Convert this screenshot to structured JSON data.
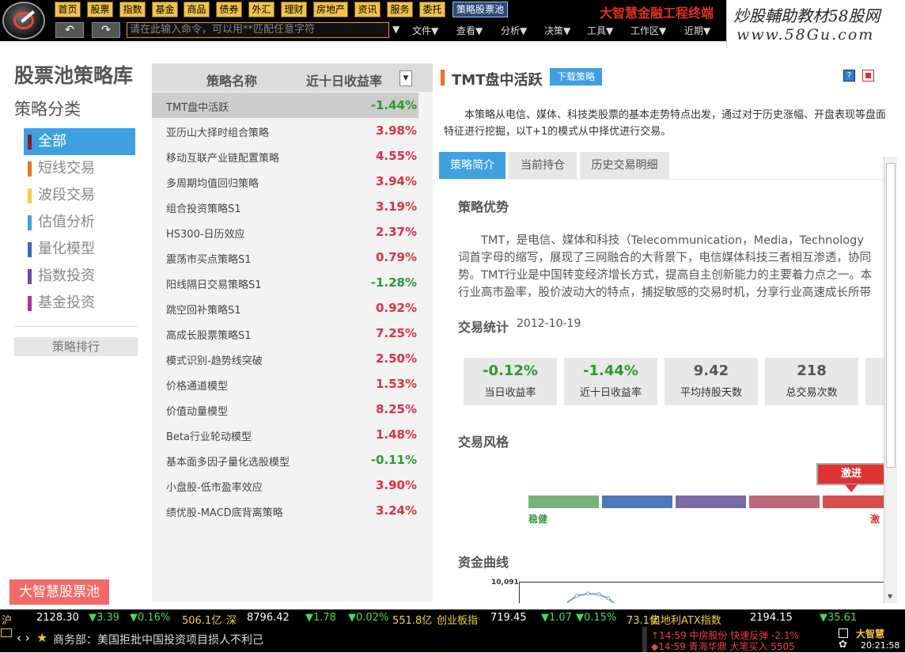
{
  "toolbar": {
    "menu": [
      "首页",
      "股票",
      "指数",
      "基金",
      "商品",
      "债券",
      "外汇",
      "理财",
      "房地产",
      "资讯",
      "服务",
      "委托",
      "策略股票池"
    ],
    "command_placeholder": "请在此输入命令，可以用**匹配任意字符",
    "dropdowns": [
      "文件▼",
      "查看▼",
      "分析▼",
      "决策▼",
      "工具▼",
      "工作区▼",
      "近期▼"
    ],
    "brand": "大智慧金融工程终端",
    "watermark_line1": "炒股輔助教材58股网",
    "watermark_line2": "www.58Gu.com"
  },
  "sidebar": {
    "title": "股票池策略库",
    "category_title": "策略分类",
    "categories": [
      {
        "label": "全部",
        "color": "#8a1a2a"
      },
      {
        "label": "短线交易",
        "color": "#f07020"
      },
      {
        "label": "波段交易",
        "color": "#f0d040"
      },
      {
        "label": "估值分析",
        "color": "#3fa0e0"
      },
      {
        "label": "量化模型",
        "color": "#3a6ab0"
      },
      {
        "label": "指数投资",
        "color": "#6a4ab0"
      },
      {
        "label": "基金投资",
        "color": "#b030b0"
      }
    ],
    "rank_button": "策略排行",
    "pool_button": "大智慧股票池"
  },
  "list": {
    "col_name": "策略名称",
    "col_return": "近十日收益率",
    "sort_icon": "▼",
    "rows": [
      {
        "name": "TMT盘中活跃",
        "ret": "-1.44%"
      },
      {
        "name": "亚历山大择时组合策略",
        "ret": "3.98%"
      },
      {
        "name": "移动互联产业链配置策略",
        "ret": "4.55%"
      },
      {
        "name": "多周期均值回归策略",
        "ret": "3.94%"
      },
      {
        "name": "组合投资策略S1",
        "ret": "3.19%"
      },
      {
        "name": "HS300-日历效应",
        "ret": "2.37%"
      },
      {
        "name": "震荡市买点策略S1",
        "ret": "0.79%"
      },
      {
        "name": "阳线隔日交易策略S1",
        "ret": "-1.28%"
      },
      {
        "name": "跳空回补策略S1",
        "ret": "0.92%"
      },
      {
        "name": "高成长股票策略S1",
        "ret": "7.25%"
      },
      {
        "name": "模式识别-趋势线突破",
        "ret": "2.50%"
      },
      {
        "name": "价格通道模型",
        "ret": "1.53%"
      },
      {
        "name": "价值动量模型",
        "ret": "8.25%"
      },
      {
        "name": "Beta行业轮动模型",
        "ret": "1.48%"
      },
      {
        "name": "基本面多因子量化选股模型",
        "ret": "-0.11%"
      },
      {
        "name": "小盘股-低市盈率效应",
        "ret": "3.90%"
      },
      {
        "name": "绩优股-MACD底背离策略",
        "ret": "3.24%"
      }
    ]
  },
  "detail": {
    "title": "TMT盘中活跃",
    "download_button": "下载策略",
    "description": "本策略从电信、媒体、科技类股票的基本走势特点出发，通过对于历史涨幅、开盘表现等盘面特征进行挖掘，以T+1的模式从中择优进行交易。",
    "tabs": [
      "策略简介",
      "当前持仓",
      "历史交易明细"
    ],
    "advantage_title": "策略优势",
    "advantage_lines": [
      "TMT，是电信、媒体和科技（Telecommunication，Media，Technology",
      "词首字母的缩写，展现了三网融合的大背景下，电信媒体科技三者相互渗透，协同",
      "势。TMT行业是中国转变经济增长方式，提高自主创新能力的主要着力点之一。本",
      "行业高市盈率，股价波动大的特点，捕捉敏感的交易时机，分享行业高速成长所带"
    ],
    "stats_title": "交易统计",
    "stats_date": "2012-10-19",
    "stats": [
      {
        "value": "-0.12%",
        "label": "当日收益率"
      },
      {
        "value": "-1.44%",
        "label": "近十日收益率"
      },
      {
        "value": "9.42",
        "label": "平均持股天数"
      },
      {
        "value": "218",
        "label": "总交易次数"
      }
    ],
    "style_title": "交易风格",
    "style_marker": "激进",
    "style_low": "稳健",
    "style_high": "激",
    "style_colors": [
      "#6aaa6a",
      "#3a6ab0",
      "#6a5a9a",
      "#b05a6a",
      "#d03a3a"
    ],
    "curve_title": "资金曲线",
    "curve_top_value": "10,091"
  },
  "ticker": [
    {
      "t": "沪",
      "c": "ty"
    },
    {
      "t": "2128.30",
      "c": "tw"
    },
    {
      "t": "▼3.39",
      "c": "tg"
    },
    {
      "t": "▼0.16%",
      "c": "tg"
    },
    {
      "t": "506.1亿",
      "c": "ty"
    },
    {
      "t": "深",
      "c": "ty"
    },
    {
      "t": "8796.42",
      "c": "tw"
    },
    {
      "t": "▼1.78",
      "c": "tg"
    },
    {
      "t": "▼0.02%",
      "c": "tg"
    },
    {
      "t": "551.8亿",
      "c": "ty"
    },
    {
      "t": "创业板指",
      "c": "ty"
    },
    {
      "t": "719.45",
      "c": "tw"
    },
    {
      "t": "▼1.07",
      "c": "tg"
    },
    {
      "t": "▼0.15%",
      "c": "tg"
    },
    {
      "t": "73.1亿",
      "c": "ty"
    },
    {
      "t": "奥地利ATX指数",
      "c": "ty"
    },
    {
      "t": "2194.15",
      "c": "tw"
    },
    {
      "t": "▼35.61",
      "c": "tg"
    }
  ],
  "newsbar": {
    "nav": "‹ ›",
    "news": "商务部：美国拒批中国投资项目损人不利己",
    "alert1": "↑14:59 中房股份 快速反弹 -2.1%",
    "alert2": "◆14:59 青海华鼎 大笔买入 5505",
    "time": "20:21:58",
    "logo_text": "大智慧"
  }
}
